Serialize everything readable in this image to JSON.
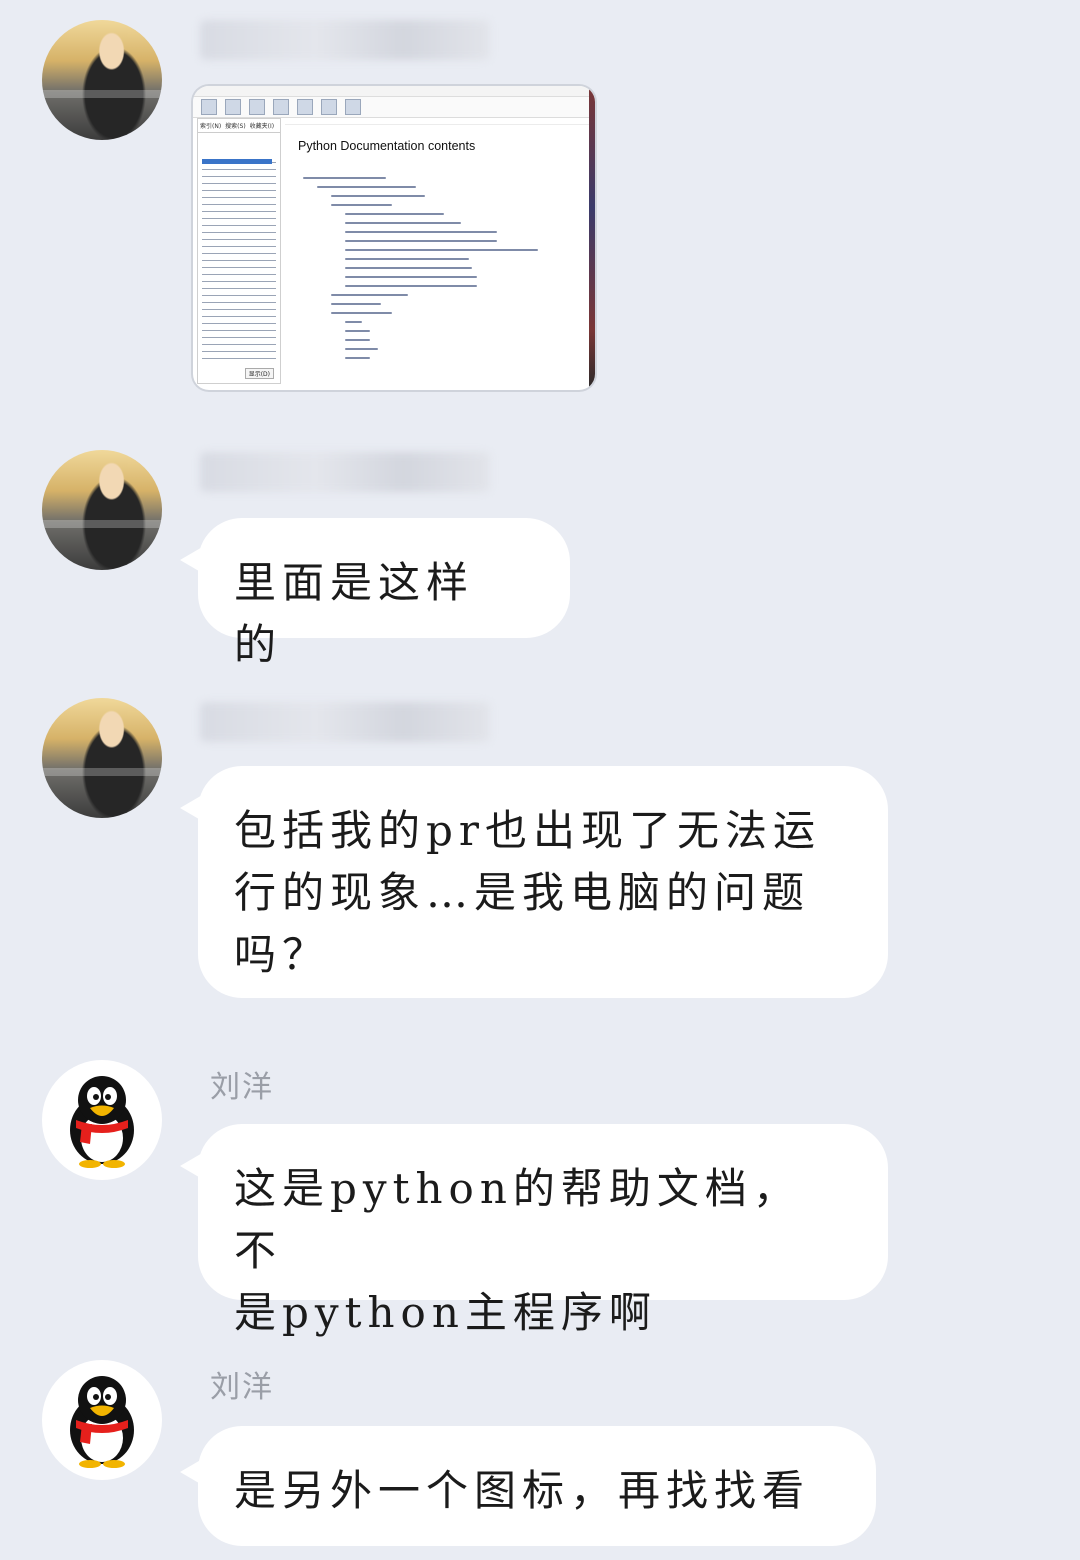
{
  "messages": [
    {
      "sender": "",
      "type": "image",
      "image": {
        "heading": "Python Documentation contents",
        "tabs": [
          "索引(N)",
          "搜索(S)",
          "收藏夹(I)"
        ],
        "display_button": "显示(D)"
      }
    },
    {
      "sender": "",
      "type": "text",
      "text": "里面是这样的"
    },
    {
      "sender": "",
      "type": "text",
      "lines": [
        "包括我的pr也出现了无法运",
        "行的现象…是我电脑的问题",
        "吗？"
      ]
    },
    {
      "sender": "刘洋",
      "type": "text",
      "lines": [
        "这是python的帮助文档，不",
        "是python主程序啊"
      ]
    },
    {
      "sender": "刘洋",
      "type": "text",
      "text": "是另外一个图标，再找找看"
    }
  ],
  "colors": {
    "background": "#e9ecf3",
    "bubble": "#ffffff",
    "name": "#9a9ea7"
  }
}
